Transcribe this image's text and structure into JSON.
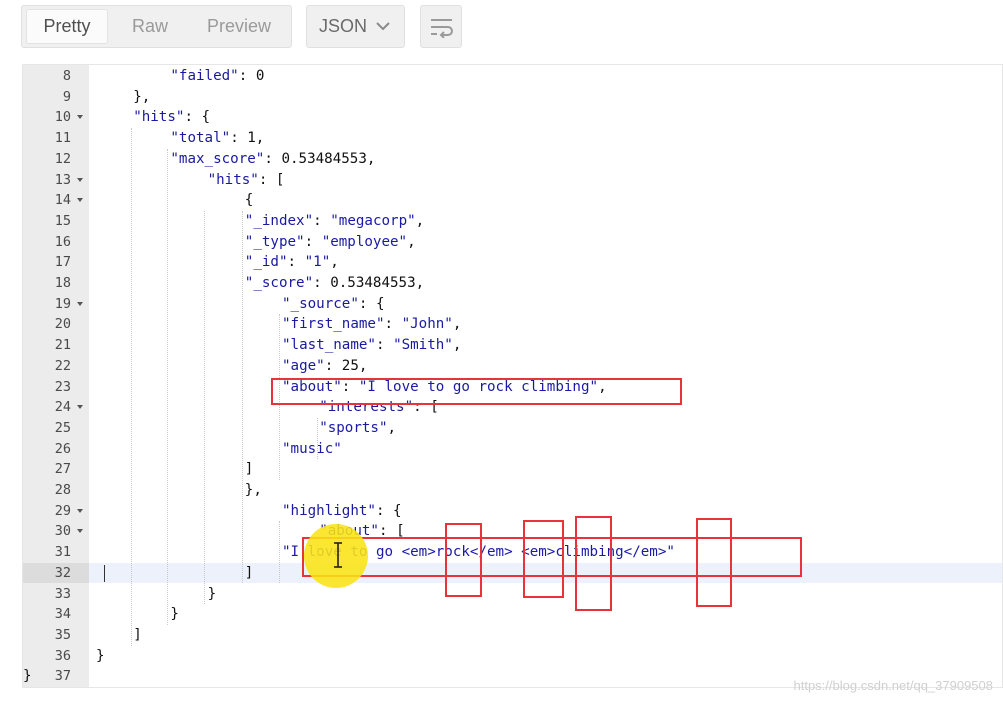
{
  "toolbar": {
    "tabs": [
      {
        "label": "Pretty",
        "active": true
      },
      {
        "label": "Raw",
        "active": false
      },
      {
        "label": "Preview",
        "active": false
      }
    ],
    "format": {
      "label": "JSON",
      "icon": "chevron-down-icon"
    },
    "wrap_icon": "wrap-lines-icon"
  },
  "editor": {
    "active_line": 32,
    "lines": [
      {
        "n": "8",
        "fold": false,
        "tokens": [
          [
            "k",
            "\"failed\""
          ],
          [
            "n",
            ": 0"
          ]
        ]
      },
      {
        "n": "9",
        "fold": false,
        "tokens": [
          [
            "n",
            "},"
          ]
        ]
      },
      {
        "n": "10",
        "fold": true,
        "tokens": [
          [
            "k",
            "\"hits\""
          ],
          [
            "n",
            ": {"
          ]
        ]
      },
      {
        "n": "11",
        "fold": false,
        "tokens": [
          [
            "k",
            "\"total\""
          ],
          [
            "n",
            ": 1,"
          ]
        ]
      },
      {
        "n": "12",
        "fold": false,
        "tokens": [
          [
            "k",
            "\"max_score\""
          ],
          [
            "n",
            ": 0.53484553,"
          ]
        ]
      },
      {
        "n": "13",
        "fold": true,
        "tokens": [
          [
            "k",
            "\"hits\""
          ],
          [
            "n",
            ": ["
          ]
        ]
      },
      {
        "n": "14",
        "fold": true,
        "tokens": [
          [
            "n",
            "{"
          ]
        ]
      },
      {
        "n": "15",
        "fold": false,
        "tokens": [
          [
            "k",
            "\"_index\""
          ],
          [
            "n",
            ": "
          ],
          [
            "s",
            "\"megacorp\""
          ],
          [
            "n",
            ","
          ]
        ]
      },
      {
        "n": "16",
        "fold": false,
        "tokens": [
          [
            "k",
            "\"_type\""
          ],
          [
            "n",
            ": "
          ],
          [
            "s",
            "\"employee\""
          ],
          [
            "n",
            ","
          ]
        ]
      },
      {
        "n": "17",
        "fold": false,
        "tokens": [
          [
            "k",
            "\"_id\""
          ],
          [
            "n",
            ": "
          ],
          [
            "s",
            "\"1\""
          ],
          [
            "n",
            ","
          ]
        ]
      },
      {
        "n": "18",
        "fold": false,
        "tokens": [
          [
            "k",
            "\"_score\""
          ],
          [
            "n",
            ": 0.53484553,"
          ]
        ]
      },
      {
        "n": "19",
        "fold": true,
        "tokens": [
          [
            "k",
            "\"_source\""
          ],
          [
            "n",
            ": {"
          ]
        ]
      },
      {
        "n": "20",
        "fold": false,
        "tokens": [
          [
            "k",
            "\"first_name\""
          ],
          [
            "n",
            ": "
          ],
          [
            "s",
            "\"John\""
          ],
          [
            "n",
            ","
          ]
        ]
      },
      {
        "n": "21",
        "fold": false,
        "tokens": [
          [
            "k",
            "\"last_name\""
          ],
          [
            "n",
            ": "
          ],
          [
            "s",
            "\"Smith\""
          ],
          [
            "n",
            ","
          ]
        ]
      },
      {
        "n": "22",
        "fold": false,
        "tokens": [
          [
            "k",
            "\"age\""
          ],
          [
            "n",
            ": 25,"
          ]
        ]
      },
      {
        "n": "23",
        "fold": false,
        "tokens": [
          [
            "k",
            "\"about\""
          ],
          [
            "n",
            ": "
          ],
          [
            "s",
            "\"I love to go rock climbing\""
          ],
          [
            "n",
            ","
          ]
        ]
      },
      {
        "n": "24",
        "fold": true,
        "tokens": [
          [
            "k",
            "\"interests\""
          ],
          [
            "n",
            ": ["
          ]
        ]
      },
      {
        "n": "25",
        "fold": false,
        "tokens": [
          [
            "s",
            "\"sports\""
          ],
          [
            "n",
            ","
          ]
        ]
      },
      {
        "n": "26",
        "fold": false,
        "tokens": [
          [
            "s",
            "\"music\""
          ]
        ]
      },
      {
        "n": "27",
        "fold": false,
        "tokens": [
          [
            "n",
            "]"
          ]
        ]
      },
      {
        "n": "28",
        "fold": false,
        "tokens": [
          [
            "n",
            "},"
          ]
        ]
      },
      {
        "n": "29",
        "fold": true,
        "tokens": [
          [
            "k",
            "\"highlight\""
          ],
          [
            "n",
            ": {"
          ]
        ]
      },
      {
        "n": "30",
        "fold": true,
        "tokens": [
          [
            "k",
            "\"about\""
          ],
          [
            "n",
            ": ["
          ]
        ]
      },
      {
        "n": "31",
        "fold": false,
        "tokens": [
          [
            "s",
            "\"I love to go <em>rock</em> <em>climbing</em>\""
          ]
        ]
      },
      {
        "n": "32",
        "fold": false,
        "tokens": [
          [
            "n",
            "]"
          ]
        ]
      },
      {
        "n": "33",
        "fold": false,
        "tokens": [
          [
            "n",
            "}"
          ]
        ]
      },
      {
        "n": "34",
        "fold": false,
        "tokens": [
          [
            "n",
            "}"
          ]
        ]
      },
      {
        "n": "35",
        "fold": false,
        "tokens": [
          [
            "n",
            "]"
          ]
        ]
      },
      {
        "n": "36",
        "fold": false,
        "tokens": [
          [
            "n",
            "}"
          ]
        ]
      },
      {
        "n": "37",
        "fold": false,
        "tokens": [
          [
            "n",
            "}"
          ]
        ]
      }
    ]
  },
  "watermark": "https://blog.csdn.net/qq_37909508"
}
